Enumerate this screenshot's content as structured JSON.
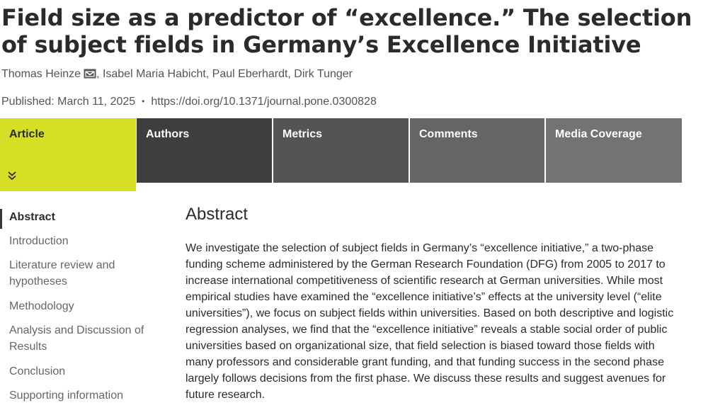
{
  "article": {
    "title": "Field size as a predictor of “excellence.” The selection of subject fields in Germany’s Excellence Initiative",
    "authors": [
      {
        "name": "Thomas Heinze",
        "has_email": true
      },
      {
        "name": "Isabel Maria Habicht"
      },
      {
        "name": "Paul Eberhardt"
      },
      {
        "name": "Dirk Tunger"
      }
    ],
    "author_separator": ", ",
    "published_label": "Published: March 11, 2025",
    "published_separator": "•",
    "doi": "https://doi.org/10.1371/journal.pone.0300828"
  },
  "tabs": [
    {
      "label": "Article",
      "active": true,
      "color": "#d5df24"
    },
    {
      "label": "Authors",
      "color": "#3e3e3e"
    },
    {
      "label": "Metrics",
      "color": "#545454"
    },
    {
      "label": "Comments",
      "color": "#656565"
    },
    {
      "label": "Media Coverage",
      "color": "#737373"
    }
  ],
  "tab_expand_icon": "double-chevron-down-icon",
  "sidebar": {
    "items": [
      {
        "label": "Abstract",
        "active": true
      },
      {
        "label": "Introduction"
      },
      {
        "label": "Literature review and hypotheses"
      },
      {
        "label": "Methodology"
      },
      {
        "label": "Analysis and Discussion of Results"
      },
      {
        "label": "Conclusion"
      },
      {
        "label": "Supporting information"
      }
    ]
  },
  "abstract": {
    "heading": "Abstract",
    "text": "We investigate the selection of subject fields in Germany’s “excellence initiative,” a two-phase funding scheme administered by the German Research Foundation (DFG) from 2005 to 2017 to increase international competitiveness of scientific research at German universities. While most empirical studies have examined the “excellence initiative’s” effects at the university level (“elite universities”), we focus on subject fields within universities. Based on both descriptive and logistic regression analyses, we find that the “excellence initiative” reveals a stable social order of public universities based on organizational size, that field selection is biased toward those fields with many professors and considerable grant funding, and that funding success in the second phase largely follows decisions from the first phase. We discuss these results and suggest avenues for future research."
  }
}
